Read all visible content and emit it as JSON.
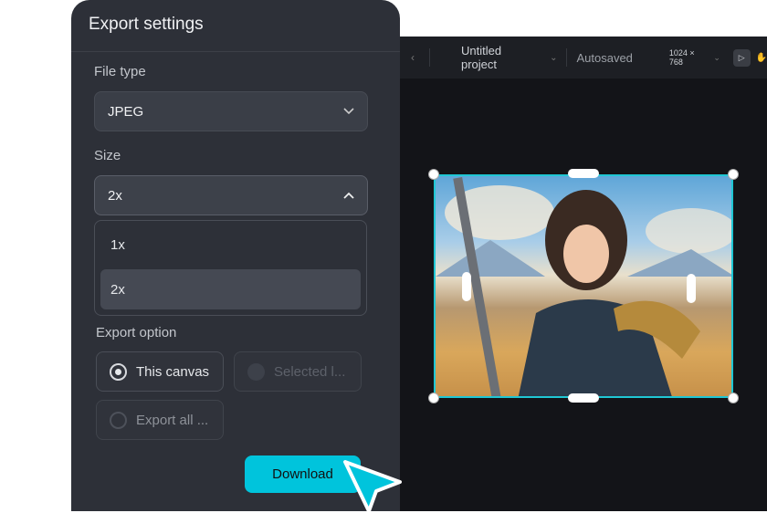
{
  "topbar": {
    "back_icon": "chevron-left-icon",
    "project_name": "Untitled project",
    "status": "Autosaved",
    "canvas_size": "1024 × 768",
    "tools": [
      "pointer-icon",
      "hand-icon"
    ]
  },
  "canvas": {
    "image": "fantasy warrior woman with sword illustration",
    "selection_color": "#1fc7d4"
  },
  "export": {
    "title": "Export settings",
    "file_type_label": "File type",
    "file_type": "JPEG",
    "size_label": "Size",
    "size": "2x",
    "size_options": [
      "1x",
      "2x"
    ],
    "export_option_label": "Export option",
    "options": [
      {
        "label": "This canvas",
        "selected": true,
        "disabled": false
      },
      {
        "label": "Selected l...",
        "selected": false,
        "disabled": true
      },
      {
        "label": "Export all ...",
        "selected": false,
        "disabled": false
      }
    ],
    "download": "Download",
    "accent": "#00c4dc"
  }
}
